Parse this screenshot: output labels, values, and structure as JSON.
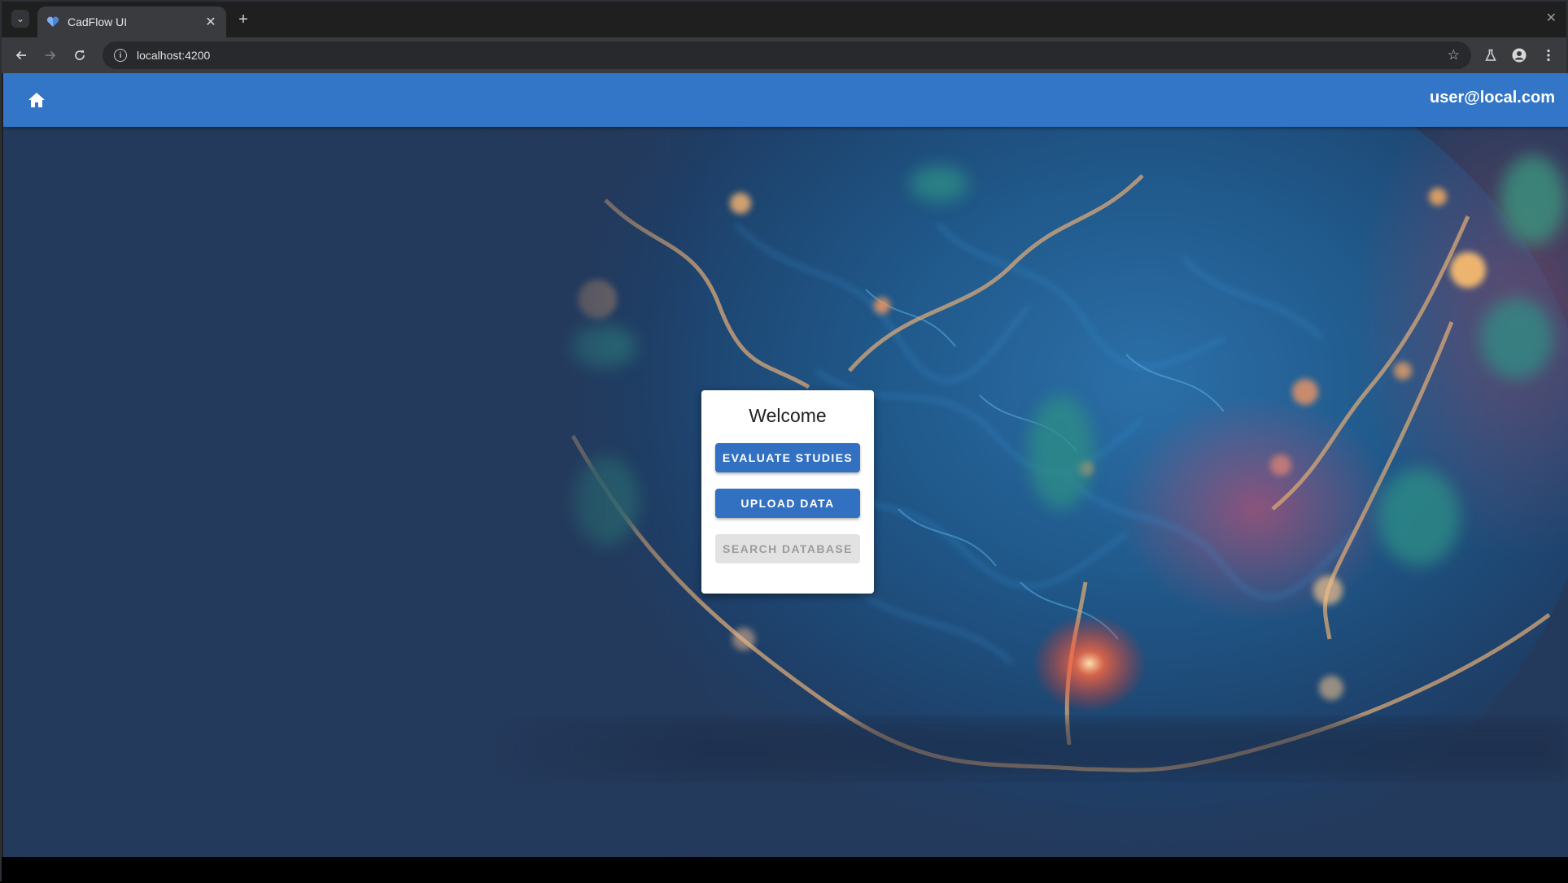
{
  "browser": {
    "tab_title": "CadFlow UI",
    "tab_close_glyph": "✕",
    "new_tab_glyph": "+",
    "window_close_glyph": "✕",
    "url": "localhost:4200"
  },
  "app": {
    "user_email": "user@local.com",
    "header_color": "#3375c6"
  },
  "welcome_card": {
    "title": "Welcome",
    "buttons": [
      {
        "label": "EVALUATE STUDIES",
        "enabled": true
      },
      {
        "label": "UPLOAD DATA",
        "enabled": true
      },
      {
        "label": "SEARCH DATABASE",
        "enabled": false
      }
    ]
  },
  "colors": {
    "primary": "#3271c2",
    "page_background": "#243a5c",
    "disabled_button": "#e2e2e2"
  },
  "icons": {
    "tab_menu": "chevron-down-icon",
    "favicon": "heart-icon",
    "back": "arrow-left-icon",
    "forward": "arrow-right-icon",
    "reload": "reload-icon",
    "site_info": "info-icon",
    "bookmark": "star-icon",
    "labs": "flask-icon",
    "profile": "person-icon",
    "menu": "kebab-menu-icon",
    "home": "home-icon"
  }
}
